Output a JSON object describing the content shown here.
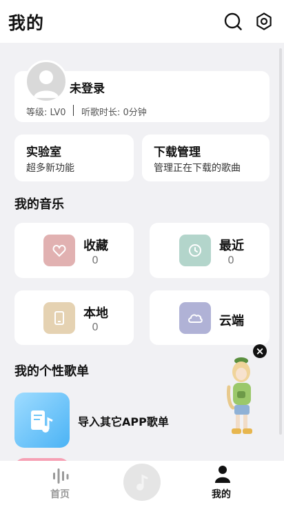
{
  "header": {
    "title": "我的",
    "search_icon": "search-icon",
    "settings_icon": "gear-icon"
  },
  "profile": {
    "username": "未登录",
    "level": "等级: LV0",
    "listen_time": "听歌时长: 0分钟"
  },
  "features": [
    {
      "title": "实验室",
      "subtitle": "超多新功能"
    },
    {
      "title": "下载管理",
      "subtitle": "管理正在下载的歌曲"
    }
  ],
  "my_music": {
    "title": "我的音乐",
    "items": [
      {
        "label": "收藏",
        "count": "0",
        "icon": "heart-icon",
        "color": "#e1b1b1"
      },
      {
        "label": "最近",
        "count": "0",
        "icon": "clock-icon",
        "color": "#b3d5cb"
      },
      {
        "label": "本地",
        "count": "0",
        "icon": "phone-icon",
        "color": "#e5d2b2"
      },
      {
        "label": "云端",
        "count": "",
        "icon": "cloud-icon",
        "color": "#b0b2d6"
      }
    ]
  },
  "playlists": {
    "title": "我的个性歌单",
    "import_label": "导入其它APP歌单"
  },
  "overlay": {
    "close": "×"
  },
  "tabbar": {
    "home": "首页",
    "mine": "我的"
  }
}
